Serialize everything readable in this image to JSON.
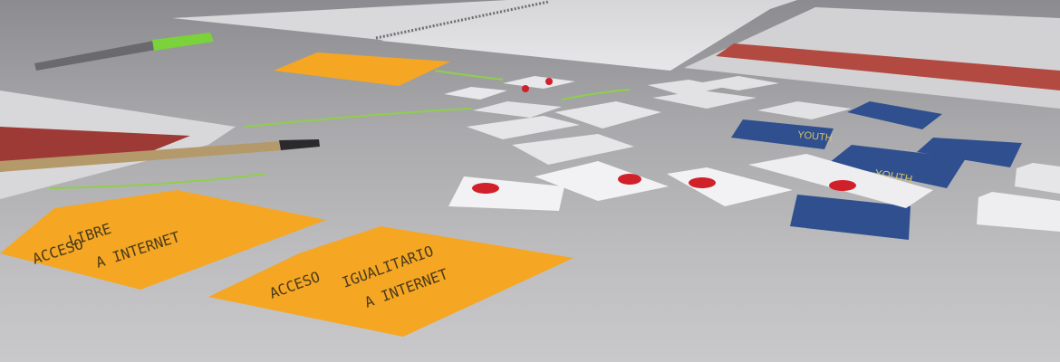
{
  "scene": {
    "sticky_notes": [
      {
        "lines": [
          "ACCESO",
          "LIBRE",
          "A INTERNET"
        ]
      },
      {
        "lines": [
          "ACCESO",
          "IGUALITARIO",
          "A INTERNET"
        ]
      }
    ],
    "sticker_text": "YOUTH",
    "colors": {
      "table": "#b8b8ba",
      "sticky_note": "#f5a623",
      "sticker_blue": "#2f4f8f",
      "heart_red": "#d0202a",
      "marker_green": "#7bd23a",
      "marker_line": "#8fcf4a"
    }
  }
}
